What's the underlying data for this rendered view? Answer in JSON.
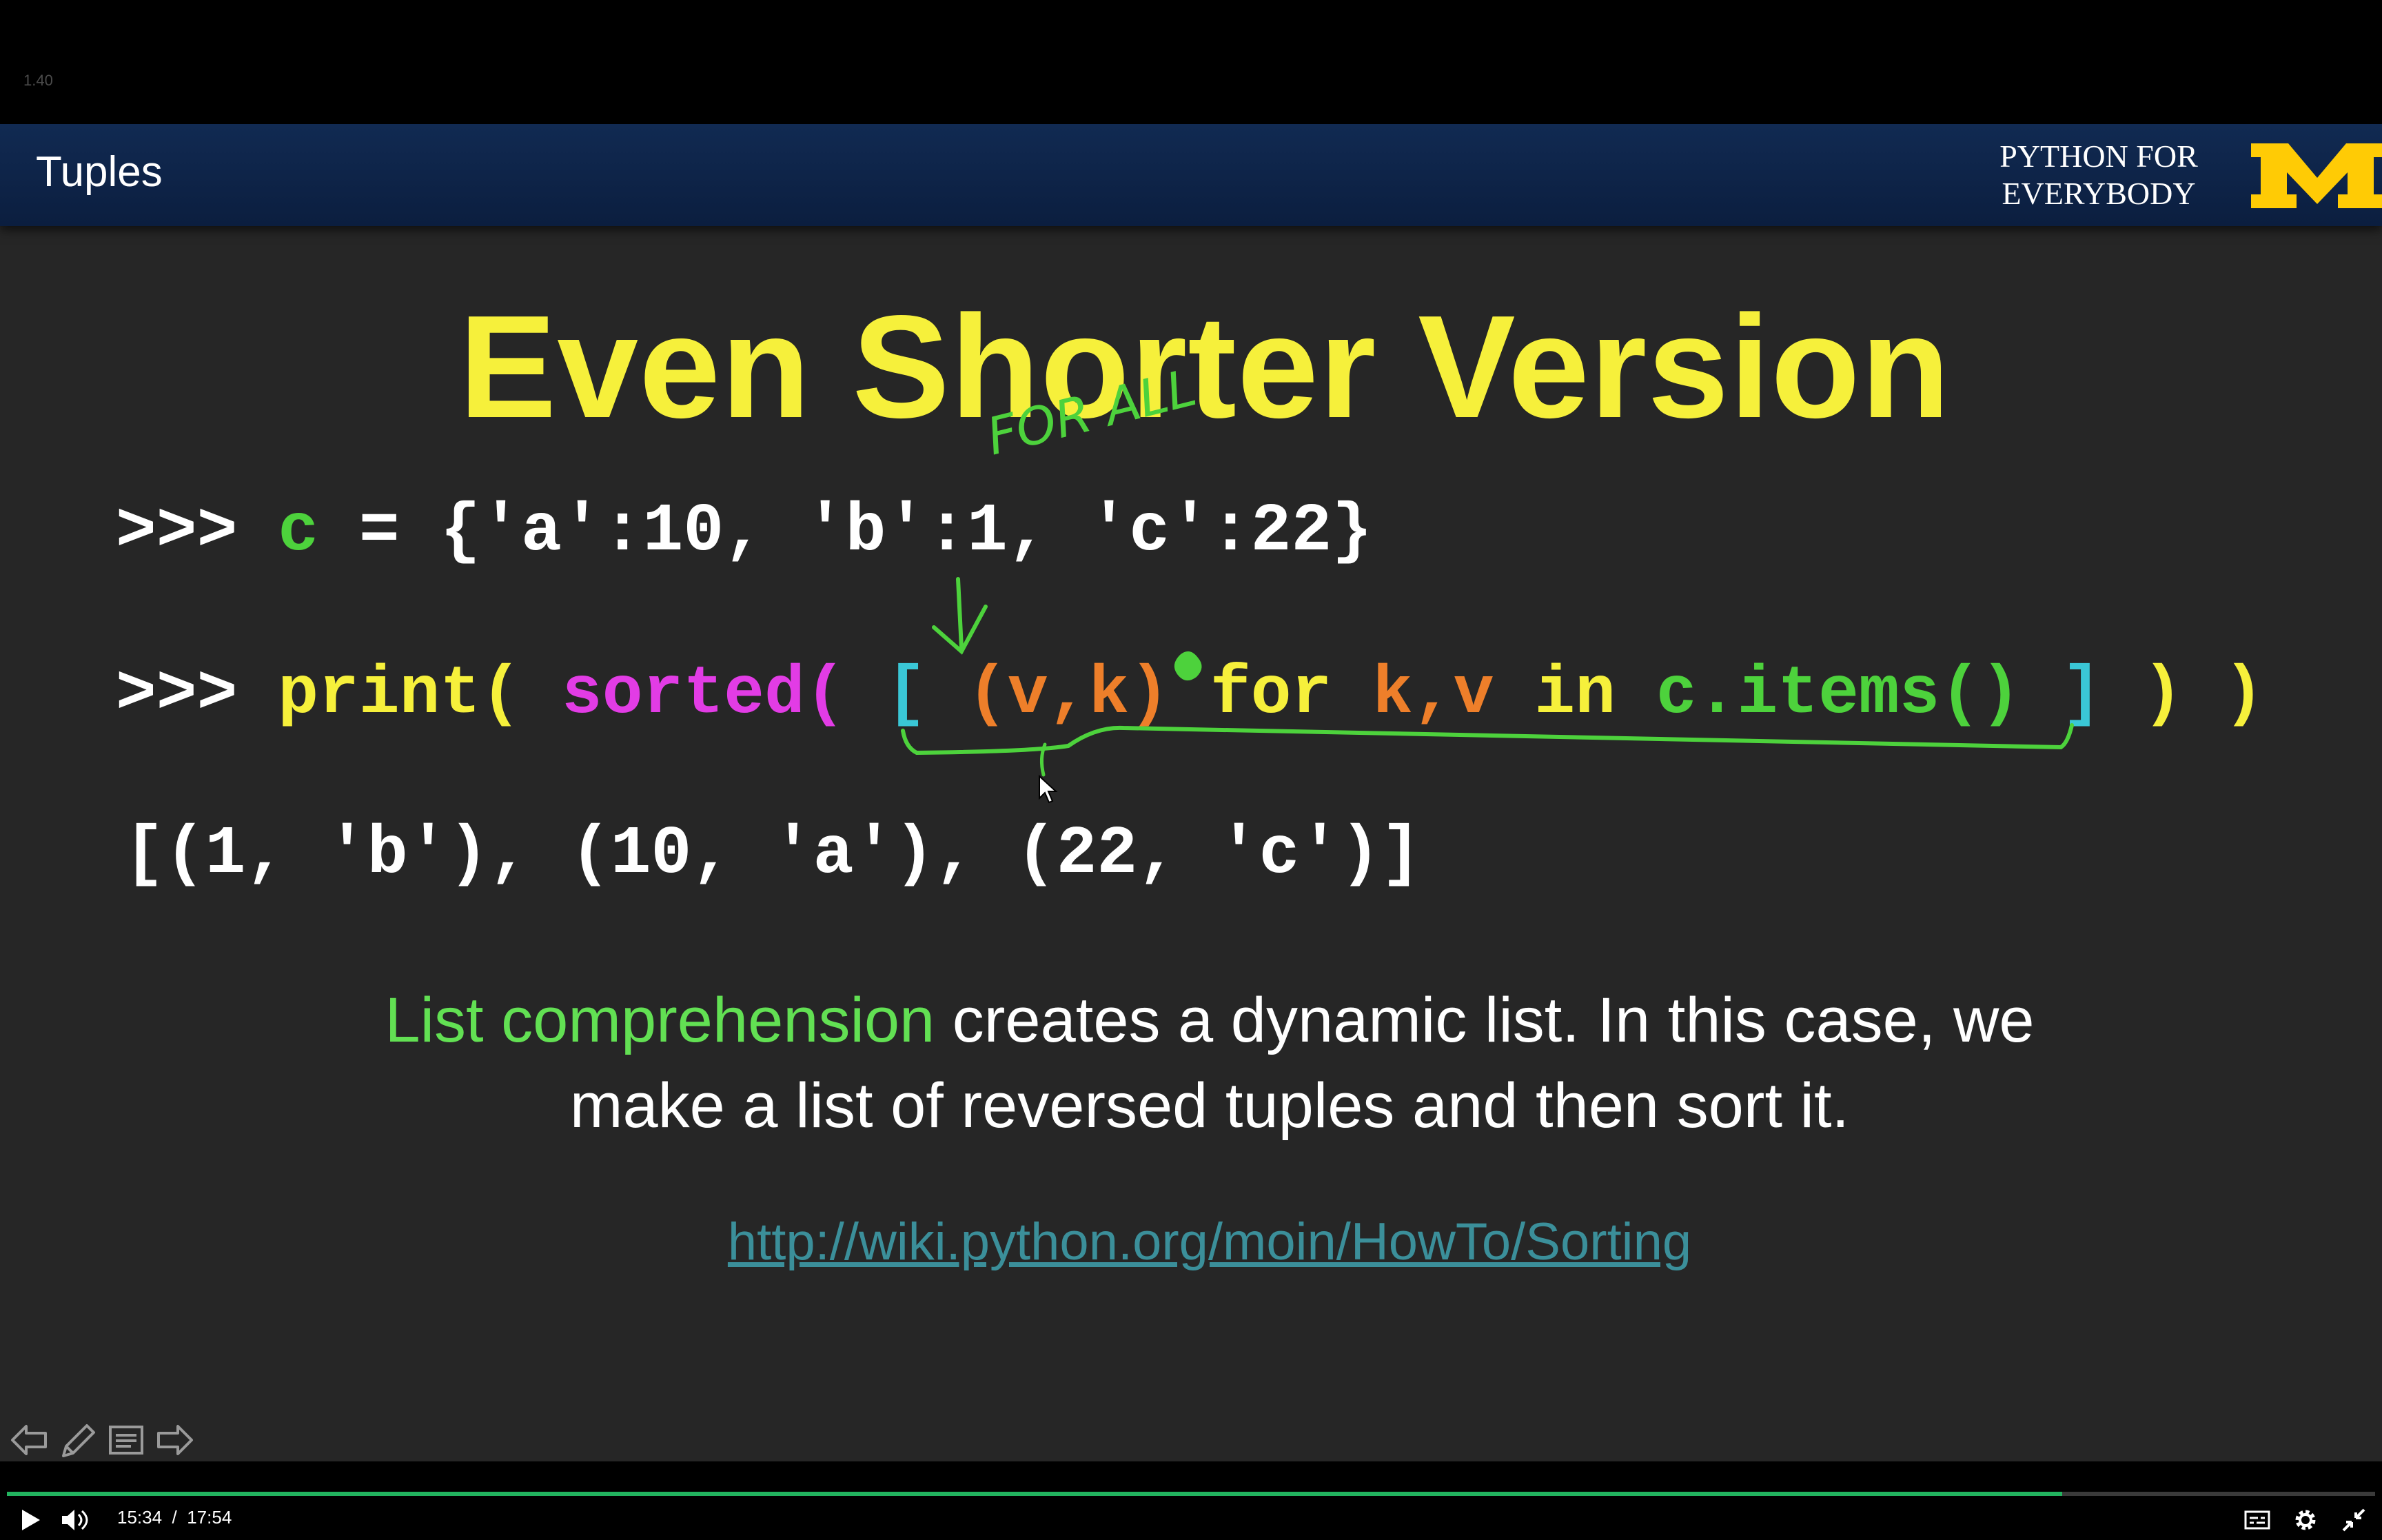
{
  "top": {
    "speed": "1.40"
  },
  "slide": {
    "section_title": "Tuples",
    "brand_line1": "PYTHON FOR",
    "brand_line2": "EVERYBODY",
    "title": "Even Shorter Version",
    "code1": {
      "prompt": ">>> ",
      "var": "c",
      "rest": " = {'a':10, 'b':1, 'c':22}"
    },
    "code2": {
      "prompt": ">>> ",
      "print": "print(",
      "sorted": " sorted(",
      "lbr": " [",
      "tuple": " (v,k)",
      "for": " for",
      "kv": " k,v",
      "in": " in",
      "call": " c.items()",
      "rbr": " ]",
      "close": " ) )"
    },
    "code3": "[(1, 'b'), (10, 'a'), (22, 'c')]",
    "desc_lead": "List comprehension",
    "desc_rest": " creates a dynamic list. In this case, we",
    "desc_line2": "make a list of reversed tuples and then sort it.",
    "link": "http://wiki.python.org/moin/HowTo/Sorting",
    "annotation": "FOR ALL"
  },
  "player": {
    "current_time": "15:34",
    "separator": "/",
    "duration": "17:54",
    "progress_fraction": 0.868
  },
  "colors": {
    "accent_green": "#22b35f",
    "title_yellow": "#f6f03b",
    "header_navy": "#0b1e3f",
    "m_maize": "#ffcb05"
  },
  "icons": [
    "prev-slide-icon",
    "pencil-icon",
    "notes-icon",
    "next-slide-icon",
    "play-icon",
    "volume-icon",
    "captions-icon",
    "settings-icon",
    "fullscreen-exit-icon"
  ]
}
